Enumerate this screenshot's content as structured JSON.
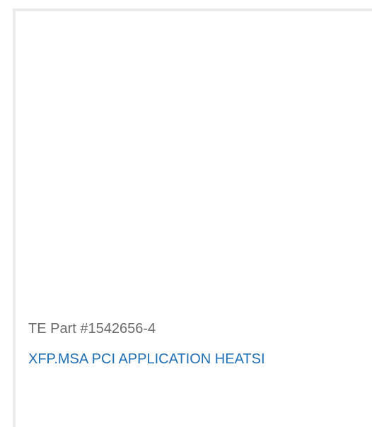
{
  "product_card": {
    "part_number_label": "TE Part #1542656-4",
    "product_title": "XFP.MSA PCI APPLICATION HEATSI"
  },
  "colors": {
    "title_link": "#1f6fb5",
    "part_number_text": "#6b6b6b",
    "card_border": "#ececec"
  }
}
